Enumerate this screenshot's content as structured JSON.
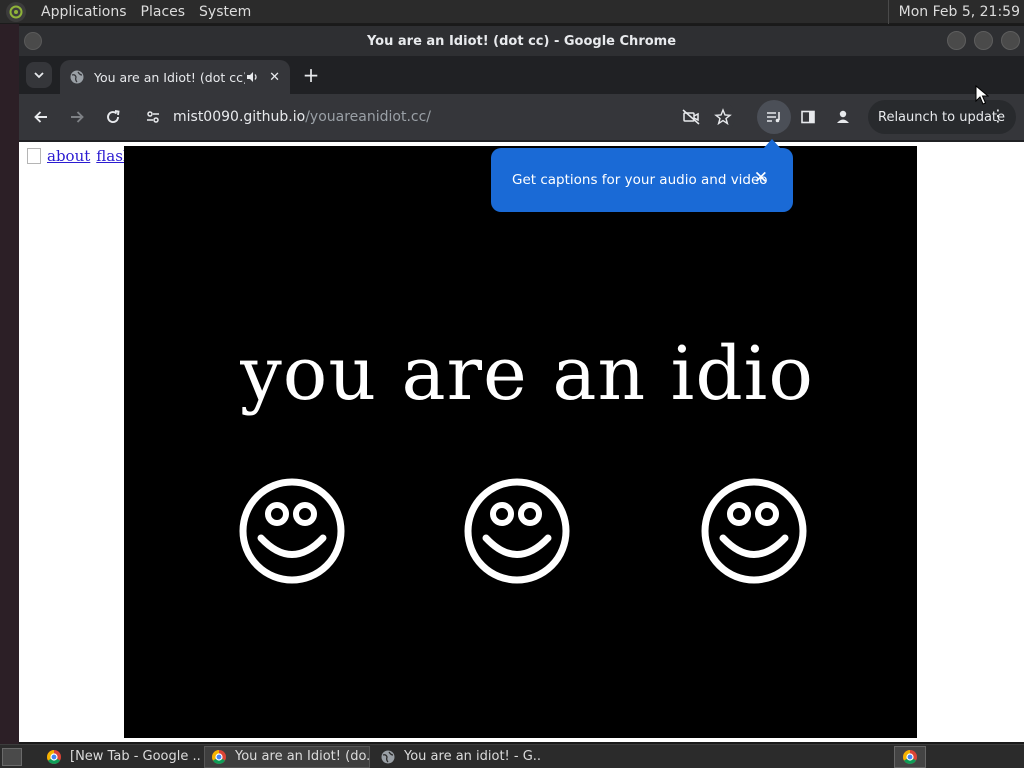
{
  "top_panel": {
    "menus": [
      "Applications",
      "Places",
      "System"
    ],
    "clock": "Mon Feb  5, 21:59"
  },
  "window": {
    "title": "You are an Idiot! (dot cc) - Google Chrome"
  },
  "tab": {
    "title": "You are an Idiot! (dot cc)",
    "close": "✕"
  },
  "new_tab_label": "+",
  "omnibox": {
    "host": "mist0090.github.io",
    "path": "/youareanidiot.cc/"
  },
  "relaunch": {
    "label": "Relaunch to update",
    "dots": "⋮"
  },
  "captions_popup": {
    "text": "Get captions for your audio and video",
    "close": "✕"
  },
  "page": {
    "links": [
      "about",
      "flash"
    ],
    "headline": "you are an idiot"
  },
  "taskbar": {
    "tasks": [
      {
        "label": "[New Tab - Google ...",
        "icon": "chrome-icon"
      },
      {
        "label": "You are an Idiot! (do...",
        "icon": "chrome-icon"
      },
      {
        "label": "You are an idiot! - G...",
        "icon": "globe-icon"
      }
    ]
  },
  "colors": {
    "chrome_bg": "#202124",
    "toolbar": "#35363a",
    "bubble_blue": "#1a6ad6",
    "link_blue": "#2a1bd1"
  }
}
